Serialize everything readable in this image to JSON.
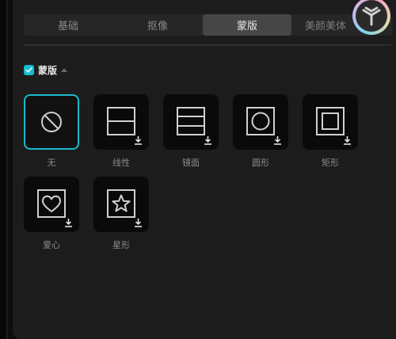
{
  "tabs": [
    {
      "label": "基础",
      "active": false
    },
    {
      "label": "抠像",
      "active": false
    },
    {
      "label": "蒙版",
      "active": true
    },
    {
      "label": "美颜美体",
      "active": false
    }
  ],
  "section": {
    "title": "蒙版",
    "checked": true
  },
  "masks": [
    {
      "label": "无",
      "icon": "none-icon",
      "selected": true
    },
    {
      "label": "线性",
      "icon": "linear-mask-icon",
      "selected": false
    },
    {
      "label": "镜面",
      "icon": "mirror-mask-icon",
      "selected": false
    },
    {
      "label": "圆形",
      "icon": "circle-mask-icon",
      "selected": false
    },
    {
      "label": "矩形",
      "icon": "rectangle-mask-icon",
      "selected": false
    },
    {
      "label": "爱心",
      "icon": "heart-mask-icon",
      "selected": false
    },
    {
      "label": "星形",
      "icon": "star-mask-icon",
      "selected": false
    }
  ],
  "colors": {
    "accent": "#14bed0",
    "panel": "#1c1c1c",
    "tile": "#0a0a0a"
  }
}
